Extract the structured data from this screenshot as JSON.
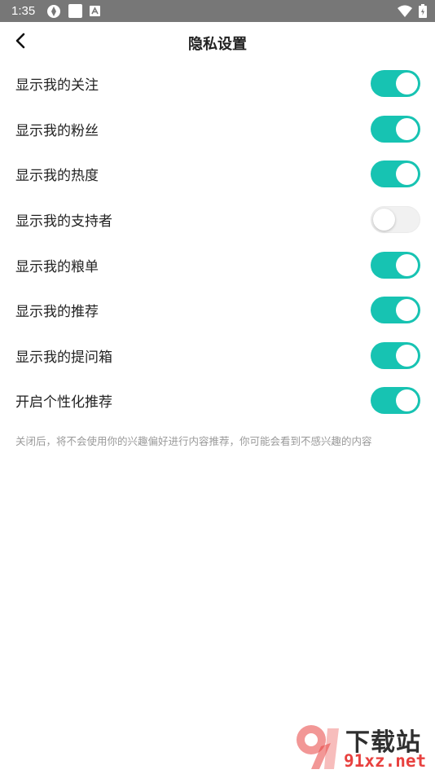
{
  "status_bar": {
    "time": "1:35",
    "left_icons": [
      "sync-icon",
      "square-icon",
      "a-box-icon"
    ],
    "right_icons": [
      "wifi-icon",
      "battery-icon"
    ]
  },
  "header": {
    "back_icon": "chevron-left-icon",
    "title": "隐私设置"
  },
  "settings": [
    {
      "label": "显示我的关注",
      "enabled": true
    },
    {
      "label": "显示我的粉丝",
      "enabled": true
    },
    {
      "label": "显示我的热度",
      "enabled": true
    },
    {
      "label": "显示我的支持者",
      "enabled": false
    },
    {
      "label": "显示我的粮单",
      "enabled": true
    },
    {
      "label": "显示我的推荐",
      "enabled": true
    },
    {
      "label": "显示我的提问箱",
      "enabled": true
    },
    {
      "label": "开启个性化推荐",
      "enabled": true
    }
  ],
  "hint": "关闭后，将不会使用你的兴趣偏好进行内容推荐，你可能会看到不感兴趣的内容",
  "watermark": {
    "logo_text": "下载站",
    "site_text": "91xz.net"
  },
  "colors": {
    "toggle_on": "#17c3b2",
    "toggle_off": "#f1f1f1",
    "status_bar": "#777777",
    "hint": "#999999"
  }
}
